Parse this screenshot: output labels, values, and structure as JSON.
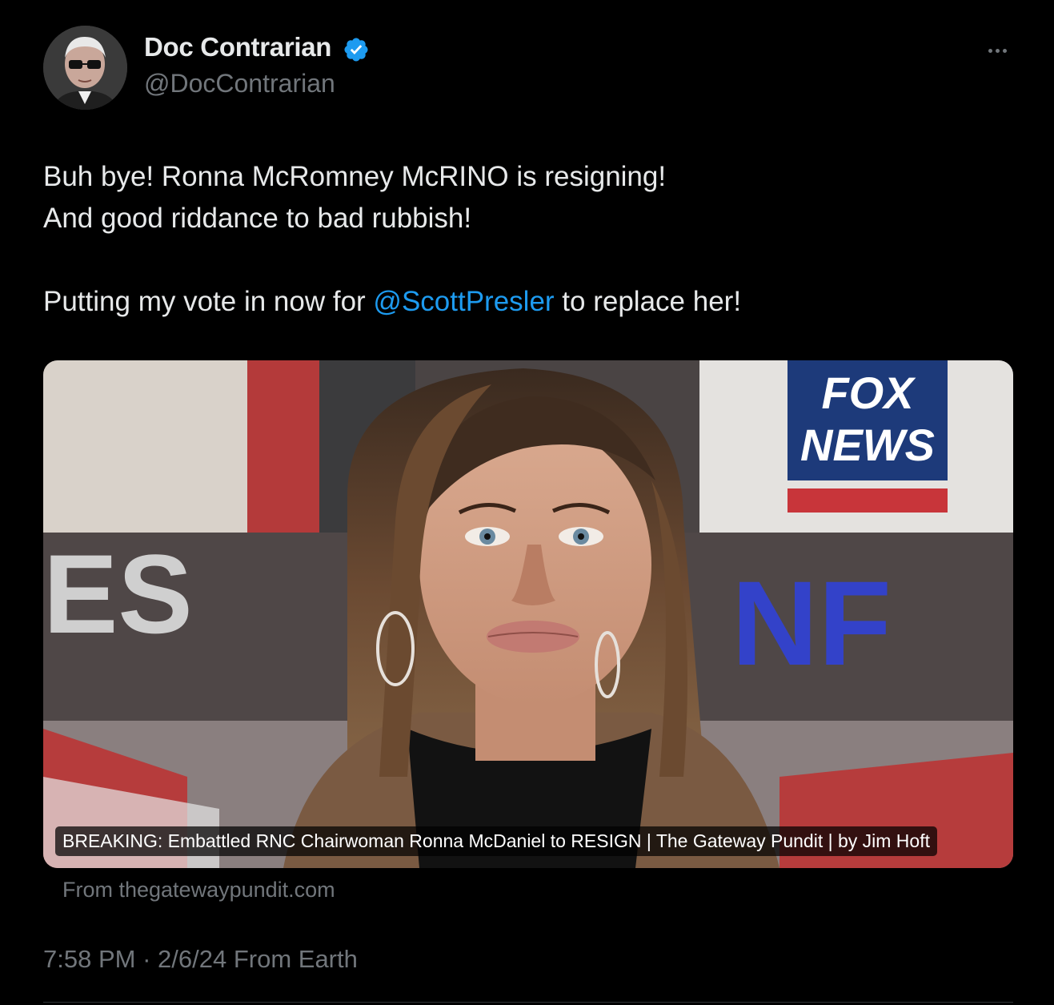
{
  "tweet": {
    "author": {
      "display_name": "Doc Contrarian",
      "handle": "@DocContrarian",
      "verified": true,
      "avatar_icon": "avatar-photo"
    },
    "more_icon": "more-options-icon",
    "text": {
      "line1": "Buh bye! Ronna McRomney McRINO is resigning!",
      "line2": "And good riddance to bad rubbish!",
      "line3_before": "Putting my vote in now for ",
      "line3_mention": "@ScottPresler",
      "line3_after": " to replace her!"
    },
    "card": {
      "caption": "BREAKING: Embattled RNC Chairwoman Ronna McDaniel to RESIGN | The Gateway Pundit | by Jim Hoft",
      "source": "From thegatewaypundit.com",
      "image_text": {
        "logo_line1": "FOX",
        "logo_line2": "NEWS",
        "background_letters_left": "ES",
        "background_letters_right": "NF"
      }
    },
    "meta": {
      "time": "7:58 PM",
      "separator": " · ",
      "date": "2/6/24",
      "source": " From Earth"
    }
  },
  "colors": {
    "background": "#000000",
    "text_primary": "#e7e9ea",
    "text_secondary": "#71767b",
    "link": "#1d9bf0",
    "verified_badge": "#1d9bf0"
  }
}
